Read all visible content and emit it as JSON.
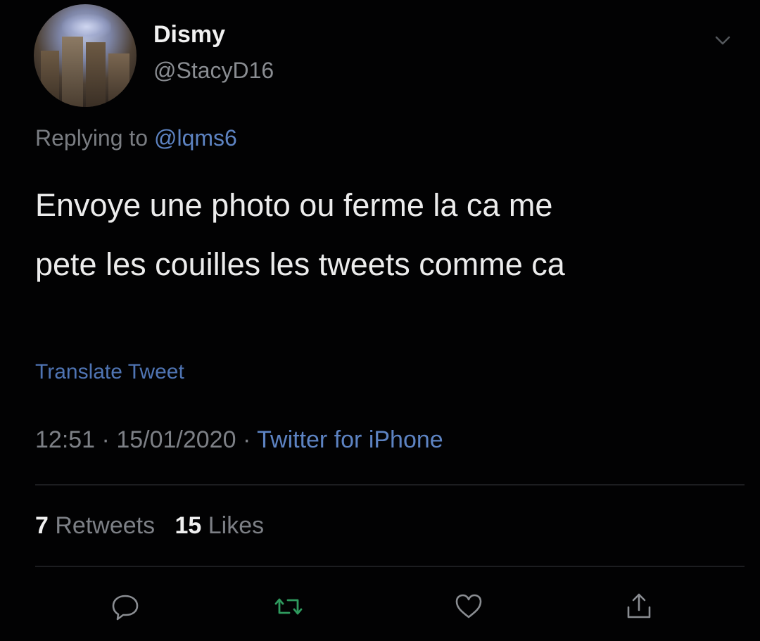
{
  "user": {
    "display_name": "Dismy",
    "handle": "@StacyD16",
    "avatar_icon": "profile-avatar-cityscape"
  },
  "reply": {
    "prefix": "Replying to",
    "mention": "@lqms6"
  },
  "tweet": {
    "line1": "Envoye une photo ou ferme la ca me",
    "line2": "pete les couilles les tweets comme ca"
  },
  "translate_label": "Translate Tweet",
  "meta": {
    "time": "12:51",
    "separator": "·",
    "date": "15/01/2020",
    "source": "Twitter for iPhone"
  },
  "stats": {
    "retweets_count": "7",
    "retweets_label": "Retweets",
    "likes_count": "15",
    "likes_label": "Likes"
  },
  "actions": {
    "reply_icon": "reply-icon",
    "retweet_icon": "retweet-icon",
    "like_icon": "heart-icon",
    "share_icon": "share-icon"
  },
  "colors": {
    "background": "#020203",
    "link": "#5d83c2",
    "muted": "#7d8086",
    "retweet_green": "#2f9a5e"
  }
}
